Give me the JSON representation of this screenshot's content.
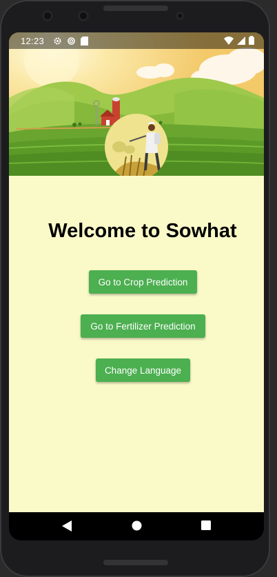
{
  "status_bar": {
    "time": "12:23",
    "icons": [
      "settings-icon",
      "settings-gear-icon",
      "sd-card-icon",
      "wifi-icon",
      "signal-icon",
      "battery-icon"
    ]
  },
  "main": {
    "title": "Welcome to Sowhat",
    "buttons": {
      "crop": "Go to Crop Prediction",
      "fertilizer": "Go to Fertilizer Prediction",
      "language": "Change Language"
    }
  },
  "navigation": {
    "icons": [
      "back-icon",
      "home-icon",
      "recents-icon"
    ]
  },
  "colors": {
    "background": "#fafac9",
    "button": "#4caf50",
    "button_text": "#ffffff"
  }
}
